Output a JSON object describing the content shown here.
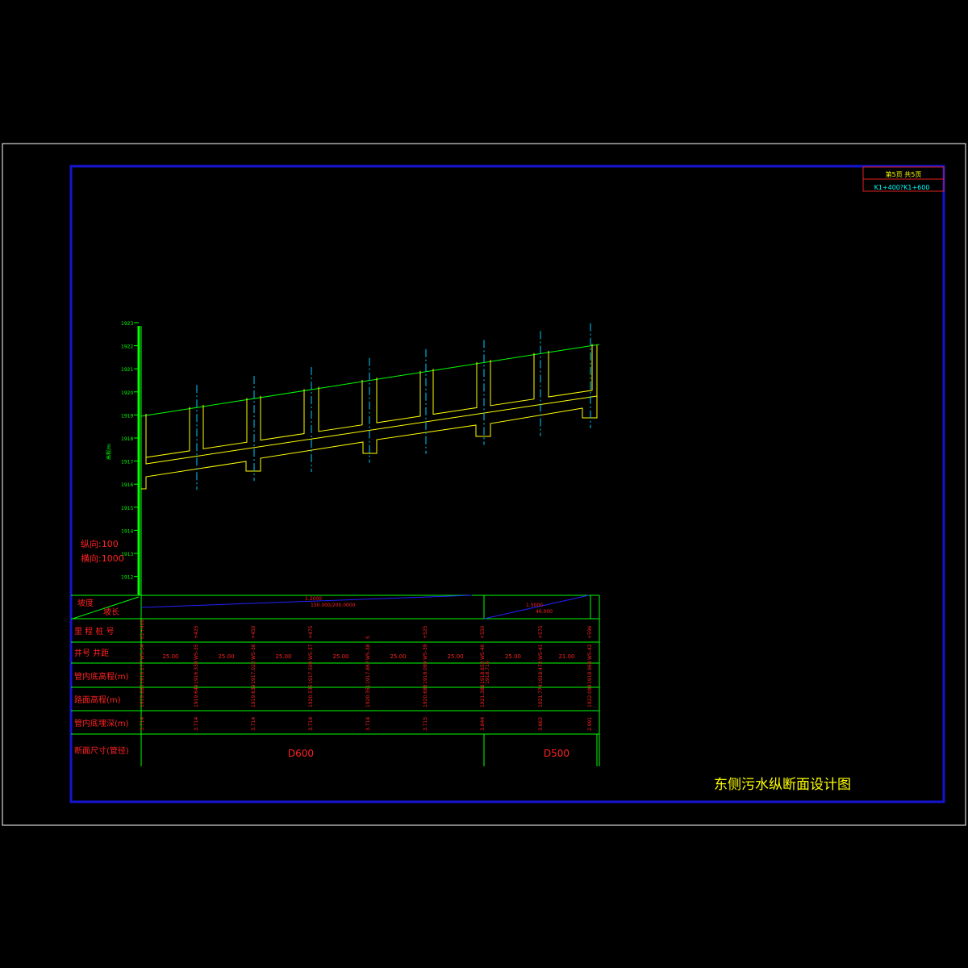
{
  "title_block": {
    "page_info": "第5页   共5页",
    "range": "K1+400?K1+600"
  },
  "drawing_title": "东侧污水纵断面设计图",
  "scales": {
    "vertical": "纵向:100",
    "horizontal": "横向:1000"
  },
  "axis": {
    "label": "高程/m",
    "ticks": [
      "1923",
      "1922",
      "1921",
      "1920",
      "1919",
      "1918",
      "1917",
      "1916",
      "1915",
      "1914",
      "1913",
      "1912"
    ]
  },
  "table": {
    "row_labels": {
      "slope": "坡度",
      "length": "坡长",
      "station": "里 程 桩 号",
      "well": "井号    井距",
      "pipe_invert": "管内底高程(m)",
      "road_elev": "路面高程(m)",
      "pipe_depth": "管内底埋深(m)",
      "section": "断面尺寸(管径)"
    },
    "slope_segments": [
      {
        "slope": "1.2000",
        "length": "150.000/200.0000"
      },
      {
        "slope": "1.5000",
        "length": "46.000"
      }
    ],
    "stations": [
      "K1+400",
      "+425",
      "+450",
      "+475",
      "5",
      "+525",
      "+550",
      "+575",
      "+596"
    ],
    "wells": [
      "W5-34",
      "W5-35",
      "W5-36",
      "W5-37",
      "W5-38",
      "W5-39",
      "W5-40",
      "W5-41",
      "W5-42"
    ],
    "distances": [
      "25.00",
      "25.00",
      "25.00",
      "25.00",
      "25.00",
      "25.00",
      "25.00",
      "21.00"
    ],
    "pipe_inverts": [
      "1916.277",
      "1916.339",
      "1917.022",
      "1917.500",
      "1917.867",
      "1918.099",
      "1918.652",
      "1918.472",
      "1918.968"
    ],
    "pipe_invert_extra": "1918.716",
    "road_elevations": [
      "1919.885",
      "1919.649",
      "1919.639",
      "1920.535",
      "1920.351",
      "1920.688",
      "1921.388",
      "1921.774",
      "1922.099"
    ],
    "pipe_depths": [
      "3.714",
      "3.714",
      "3.714",
      "3.714",
      "3.714",
      "3.715",
      "3.844",
      "3.862",
      "2.991"
    ],
    "sections": [
      "D600",
      "D500"
    ]
  }
}
